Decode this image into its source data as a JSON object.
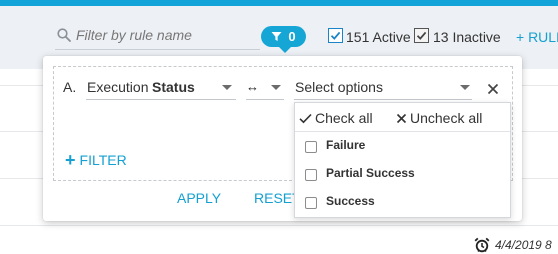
{
  "toolbar": {
    "search": {
      "placeholder": "Filter by rule name",
      "value": ""
    },
    "filter_count": "0",
    "active_label": "151 Active",
    "inactive_label": "13 Inactive",
    "add_rule_label": "+ RULE"
  },
  "filter_panel": {
    "row_letter": "A.",
    "field_part1": "Execution",
    "field_part2": "Status",
    "operator_symbol": "↔",
    "value_placeholder": "Select options",
    "add_filter_label": "FILTER",
    "apply_label": "APPLY",
    "reset_label": "RESET"
  },
  "options_dropdown": {
    "check_all_label": "Check all",
    "uncheck_all_label": "Uncheck all",
    "options": [
      {
        "label": "Failure",
        "checked": false
      },
      {
        "label": "Partial Success",
        "checked": false
      },
      {
        "label": "Success",
        "checked": false
      }
    ]
  },
  "background": {
    "date_text": "4/4/2019 8"
  },
  "colors": {
    "accent": "#15a6d6",
    "toolbar_bg": "#edf0f4"
  }
}
